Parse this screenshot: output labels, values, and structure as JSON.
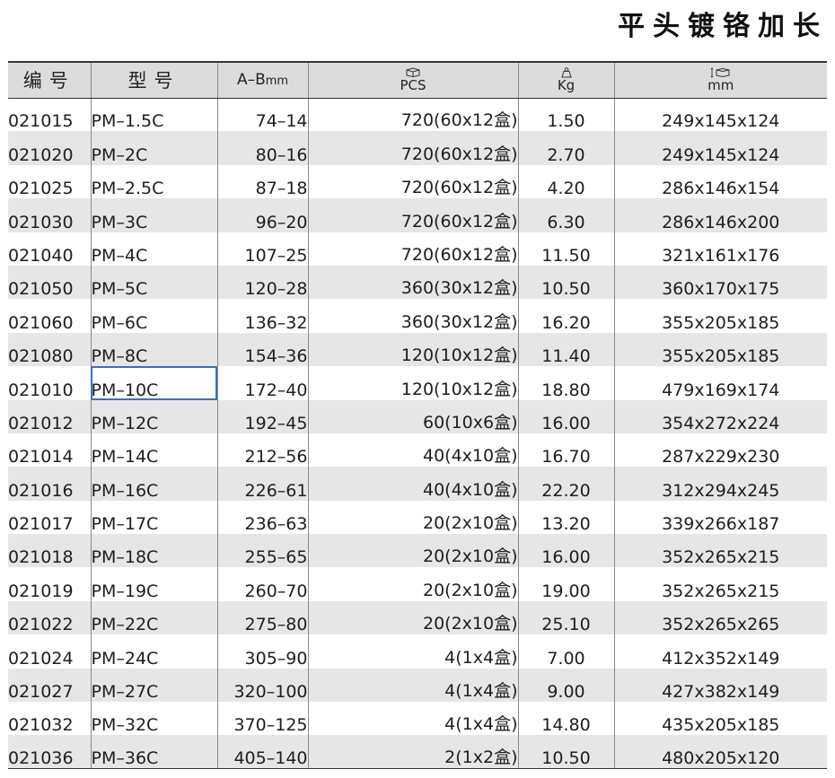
{
  "title": "平头镀铬加长",
  "headers": {
    "code": "编号",
    "model": "型号",
    "ab_main": "A–B",
    "ab_unit": "mm",
    "pcs_icon": "box-icon",
    "pcs": "PCS",
    "kg_icon": "weight-icon",
    "kg": "Kg",
    "dim_icon": "carton-dimension-icon",
    "dim": "mm"
  },
  "selected_row": 8,
  "rows": [
    {
      "code": "021015",
      "model": "PM–1.5C",
      "ab": "74–14",
      "pcs": "720(60x12盒)",
      "kg": "1.50",
      "dim": "249x145x124"
    },
    {
      "code": "021020",
      "model": "PM–2C",
      "ab": "80–16",
      "pcs": "720(60x12盒)",
      "kg": "2.70",
      "dim": "249x145x124"
    },
    {
      "code": "021025",
      "model": "PM–2.5C",
      "ab": "87–18",
      "pcs": "720(60x12盒)",
      "kg": "4.20",
      "dim": "286x146x154"
    },
    {
      "code": "021030",
      "model": "PM–3C",
      "ab": "96–20",
      "pcs": "720(60x12盒)",
      "kg": "6.30",
      "dim": "286x146x200"
    },
    {
      "code": "021040",
      "model": "PM–4C",
      "ab": "107–25",
      "pcs": "720(60x12盒)",
      "kg": "11.50",
      "dim": "321x161x176"
    },
    {
      "code": "021050",
      "model": "PM–5C",
      "ab": "120–28",
      "pcs": "360(30x12盒)",
      "kg": "10.50",
      "dim": "360x170x175"
    },
    {
      "code": "021060",
      "model": "PM–6C",
      "ab": "136–32",
      "pcs": "360(30x12盒)",
      "kg": "16.20",
      "dim": "355x205x185"
    },
    {
      "code": "021080",
      "model": "PM–8C",
      "ab": "154–36",
      "pcs": "120(10x12盒)",
      "kg": "11.40",
      "dim": "355x205x185"
    },
    {
      "code": "021010",
      "model": "PM–10C",
      "ab": "172–40",
      "pcs": "120(10x12盒)",
      "kg": "18.80",
      "dim": "479x169x174"
    },
    {
      "code": "021012",
      "model": "PM–12C",
      "ab": "192–45",
      "pcs": "60(10x6盒)",
      "kg": "16.00",
      "dim": "354x272x224"
    },
    {
      "code": "021014",
      "model": "PM–14C",
      "ab": "212–56",
      "pcs": "40(4x10盒)",
      "kg": "16.70",
      "dim": "287x229x230"
    },
    {
      "code": "021016",
      "model": "PM–16C",
      "ab": "226–61",
      "pcs": "40(4x10盒)",
      "kg": "22.20",
      "dim": "312x294x245"
    },
    {
      "code": "021017",
      "model": "PM–17C",
      "ab": "236–63",
      "pcs": "20(2x10盒)",
      "kg": "13.20",
      "dim": "339x266x187"
    },
    {
      "code": "021018",
      "model": "PM–18C",
      "ab": "255–65",
      "pcs": "20(2x10盒)",
      "kg": "16.00",
      "dim": "352x265x215"
    },
    {
      "code": "021019",
      "model": "PM–19C",
      "ab": "260–70",
      "pcs": "20(2x10盒)",
      "kg": "19.00",
      "dim": "352x265x215"
    },
    {
      "code": "021022",
      "model": "PM–22C",
      "ab": "275–80",
      "pcs": "20(2x10盒)",
      "kg": "25.10",
      "dim": "352x265x265"
    },
    {
      "code": "021024",
      "model": "PM–24C",
      "ab": "305–90",
      "pcs": "4(1x4盒)",
      "kg": "7.00",
      "dim": "412x352x149"
    },
    {
      "code": "021027",
      "model": "PM–27C",
      "ab": "320–100",
      "pcs": "4(1x4盒)",
      "kg": "9.00",
      "dim": "427x382x149"
    },
    {
      "code": "021032",
      "model": "PM–32C",
      "ab": "370–125",
      "pcs": "4(1x4盒)",
      "kg": "14.80",
      "dim": "435x205x185"
    },
    {
      "code": "021036",
      "model": "PM–36C",
      "ab": "405–140",
      "pcs": "2(1x2盒)",
      "kg": "10.50",
      "dim": "480x205x120"
    }
  ]
}
